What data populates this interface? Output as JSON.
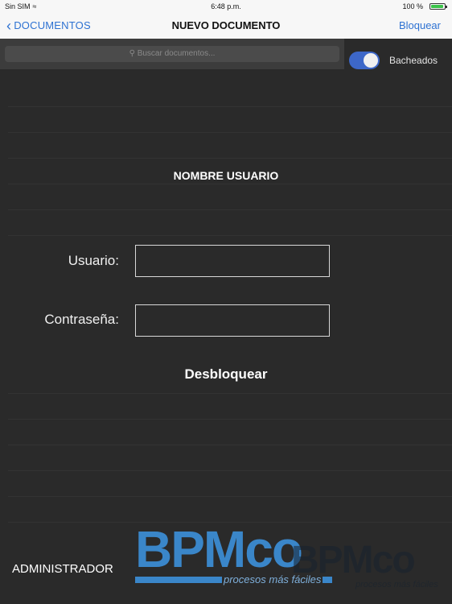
{
  "statusbar": {
    "carrier": "Sin SIM",
    "time": "6:48 p.m.",
    "battery": "100 %"
  },
  "nav": {
    "back_label": "DOCUMENTOS",
    "title": "NUEVO DOCUMENTO",
    "right_label": "Bloquear"
  },
  "search": {
    "placeholder": "Buscar documentos..."
  },
  "toggle": {
    "label": "Bacheados",
    "on": true
  },
  "form": {
    "title": "NOMBRE USUARIO",
    "user_label": "Usuario:",
    "user_value": "",
    "password_label": "Contraseña:",
    "password_value": "",
    "unlock_label": "Desbloquear"
  },
  "footer": {
    "role": "ADMINISTRADOR"
  },
  "logo": {
    "wordmark": "BPMco",
    "tagline": "procesos más fáciles"
  },
  "colors": {
    "accent": "#2e72d2",
    "background": "#2a2a2a",
    "toggle_on": "#3d67c8",
    "logo": "#3a86c9"
  }
}
